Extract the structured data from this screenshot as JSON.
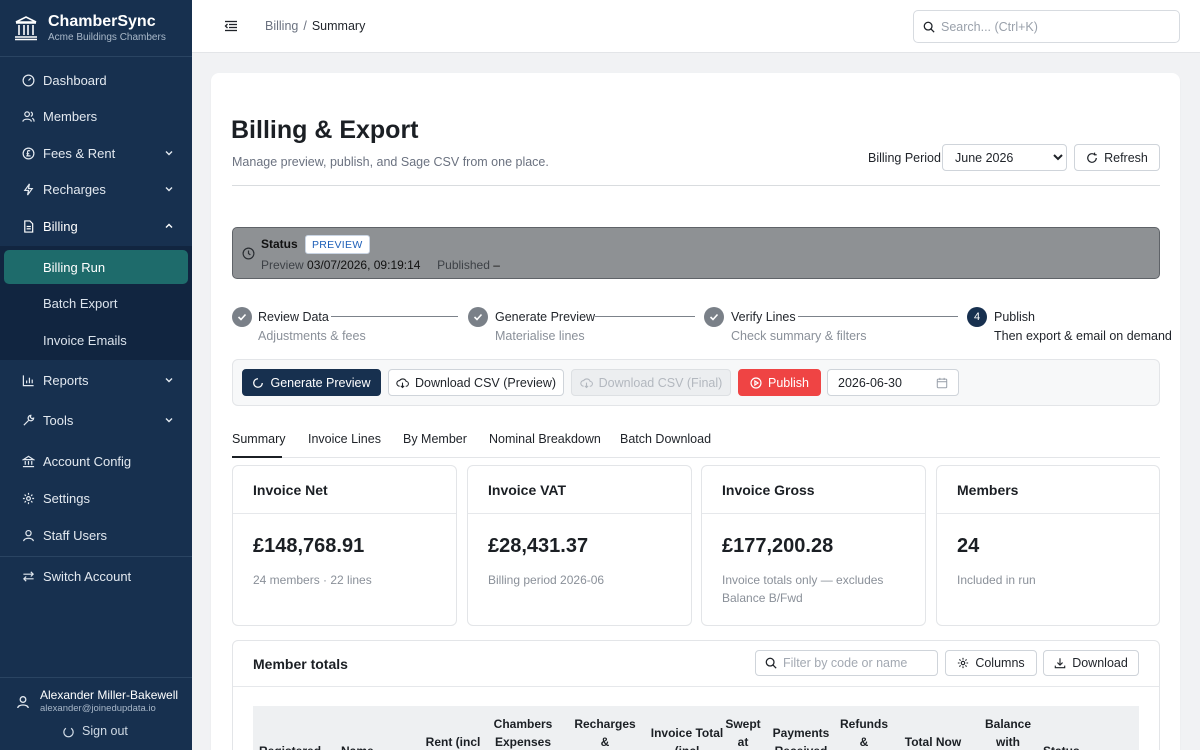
{
  "brand": {
    "title": "ChamberSync",
    "subtitle": "Acme Buildings Chambers"
  },
  "sidebar": {
    "items": [
      {
        "label": "Dashboard"
      },
      {
        "label": "Members"
      },
      {
        "label": "Fees & Rent"
      },
      {
        "label": "Recharges"
      },
      {
        "label": "Billing"
      },
      {
        "label": "Reports"
      },
      {
        "label": "Tools"
      },
      {
        "label": "Account Config"
      },
      {
        "label": "Settings"
      },
      {
        "label": "Staff Users"
      },
      {
        "label": "Switch Account"
      }
    ],
    "billing_sub": [
      {
        "label": "Billing Run"
      },
      {
        "label": "Batch Export"
      },
      {
        "label": "Invoice Emails"
      }
    ]
  },
  "user": {
    "name": "Alexander Miller-Bakewell",
    "email": "alexander@joinedupdata.io",
    "signout_label": "Sign out"
  },
  "topbar": {
    "breadcrumb": {
      "parent": "Billing",
      "separator": "/",
      "current": "Summary"
    },
    "search_placeholder": "Search... (Ctrl+K)"
  },
  "page": {
    "title": "Billing & Export",
    "subtitle": "Manage preview, publish, and Sage CSV from one place.",
    "period_label": "Billing Period",
    "period_value": "June 2026",
    "refresh_label": "Refresh"
  },
  "status": {
    "label": "Status",
    "badge": "PREVIEW",
    "preview_label": "Preview",
    "preview_time": "03/07/2026, 09:19:14",
    "published_label": "Published",
    "published_value": "–"
  },
  "steps": [
    {
      "title": "Review Data",
      "desc": "Adjustments & fees",
      "state": "done"
    },
    {
      "title": "Generate Preview",
      "desc": "Materialise lines",
      "state": "done"
    },
    {
      "title": "Verify Lines",
      "desc": "Check summary & filters",
      "state": "done"
    },
    {
      "number": "4",
      "title": "Publish",
      "desc": "Then export & email on demand",
      "state": "current"
    }
  ],
  "actions": {
    "generate_preview": "Generate Preview",
    "download_preview": "Download CSV (Preview)",
    "download_final": "Download CSV (Final)",
    "publish": "Publish",
    "date_value": "2026-06-30"
  },
  "tabs": [
    {
      "label": "Summary"
    },
    {
      "label": "Invoice Lines"
    },
    {
      "label": "By Member"
    },
    {
      "label": "Nominal Breakdown"
    },
    {
      "label": "Batch Download"
    }
  ],
  "kpis": [
    {
      "title": "Invoice Net",
      "value": "£148,768.91",
      "note": "24 members · 22 lines"
    },
    {
      "title": "Invoice VAT",
      "value": "£28,431.37",
      "note": "Billing period 2026-06"
    },
    {
      "title": "Invoice Gross",
      "value": "£177,200.28",
      "note": "Invoice totals only — excludes Balance B/Fwd"
    },
    {
      "title": "Members",
      "value": "24",
      "note": "Included in run"
    }
  ],
  "member_totals": {
    "title": "Member totals",
    "filter_placeholder": "Filter by code or name",
    "columns_label": "Columns",
    "download_label": "Download",
    "headers": [
      "Registered",
      "Name",
      "Rent (incl",
      "Chambers Expenses",
      "Recharges &",
      "Invoice Total (incl",
      "Swept at",
      "Payments Received",
      "Refunds &",
      "Total Now",
      "Balance with",
      "Status"
    ]
  },
  "colors": {
    "sidebar_bg": "#17304f",
    "active_nav": "#1e6b6b",
    "primary": "#17304f",
    "publish": "#ef4444"
  }
}
